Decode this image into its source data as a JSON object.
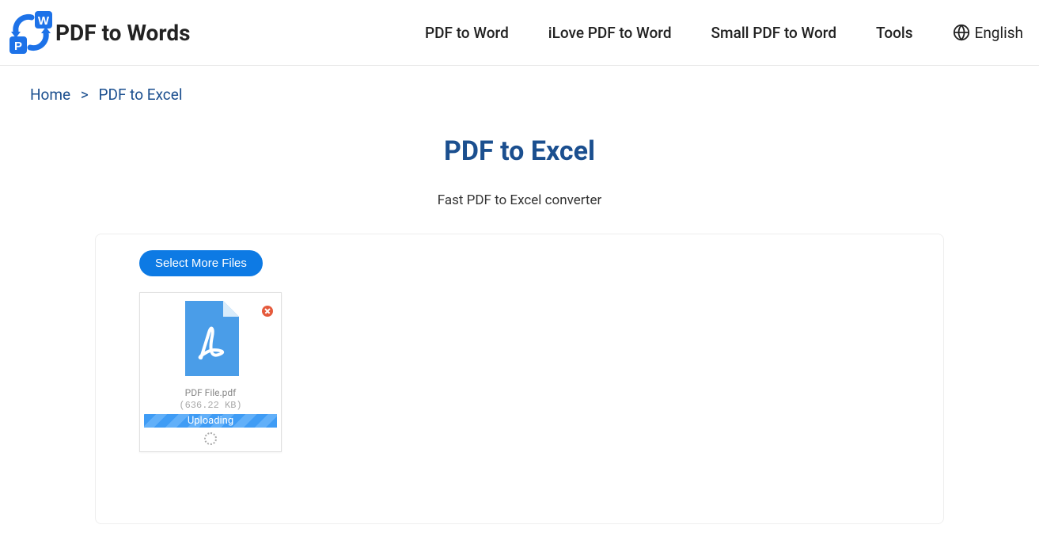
{
  "brand": "PDF to Words",
  "nav": {
    "items": [
      "PDF to Word",
      "iLove PDF to Word",
      "Small PDF to Word",
      "Tools"
    ],
    "language": "English"
  },
  "breadcrumb": {
    "home": "Home",
    "current": "PDF to Excel"
  },
  "page": {
    "title": "PDF to Excel",
    "subtitle": "Fast PDF to Excel converter"
  },
  "converter": {
    "select_more_label": "Select More Files",
    "file": {
      "name": "PDF File.pdf",
      "size": "(636.22 KB)",
      "status": "Uploading"
    }
  }
}
